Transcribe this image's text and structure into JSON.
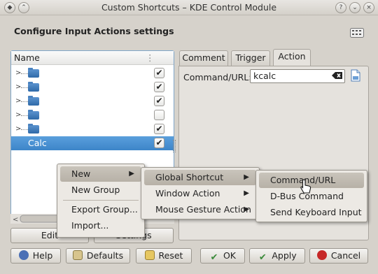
{
  "window": {
    "title": "Custom Shortcuts – KDE Control Module"
  },
  "heading": "Configure Input Actions settings",
  "tree": {
    "column": "Name",
    "rows": [
      {
        "checked": true
      },
      {
        "checked": true
      },
      {
        "checked": true
      },
      {
        "checked": false
      },
      {
        "checked": true
      }
    ],
    "selected": {
      "label": "Calc",
      "checked": true
    }
  },
  "tabs": [
    "Comment",
    "Trigger",
    "Action"
  ],
  "action": {
    "label": "Command/URL:",
    "value": "kcalc"
  },
  "tree_buttons": {
    "edit": "Edit",
    "settings": "Settings"
  },
  "buttons": {
    "help": "Help",
    "defaults": "Defaults",
    "reset": "Reset",
    "ok": "OK",
    "apply": "Apply",
    "cancel": "Cancel"
  },
  "menu1": {
    "new": "New",
    "new_group": "New Group",
    "export": "Export Group...",
    "import": "Import..."
  },
  "menu2": {
    "global": "Global Shortcut",
    "window": "Window Action",
    "gesture": "Mouse Gesture Action"
  },
  "menu3": {
    "command": "Command/URL",
    "dbus": "D-Bus Command",
    "keyboard": "Send Keyboard Input"
  },
  "check_mark": "✔",
  "colors": {
    "selection": "#3d85c9",
    "help": "#4a6fb5",
    "ok": "#3a8a3a",
    "cancel": "#c62828"
  }
}
